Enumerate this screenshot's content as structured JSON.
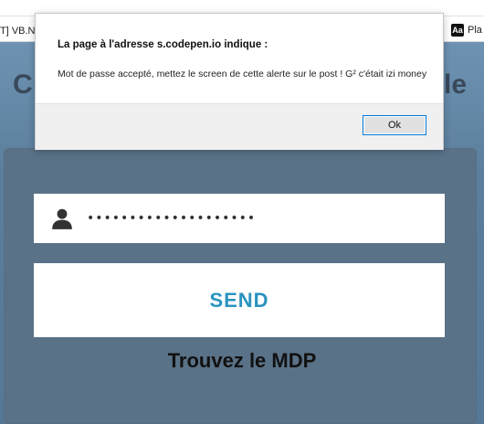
{
  "bookmarks": {
    "left_label": "T] VB.NE",
    "right_label": "Pla",
    "right_favicon": "Aa"
  },
  "page": {
    "heading_left_fragment": "C",
    "heading_right_fragment": "le",
    "password_value": "••••••••••••••••••••",
    "send_label": "SEND",
    "hint": "Trouvez le MDP",
    "accent_color": "#2a93c0"
  },
  "alert": {
    "title": "La page à l'adresse s.codepen.io indique :",
    "message": "Mot de passe accepté, mettez le screen de cette alerte sur le post ! G² c'était izi money",
    "ok_label": "Ok"
  }
}
